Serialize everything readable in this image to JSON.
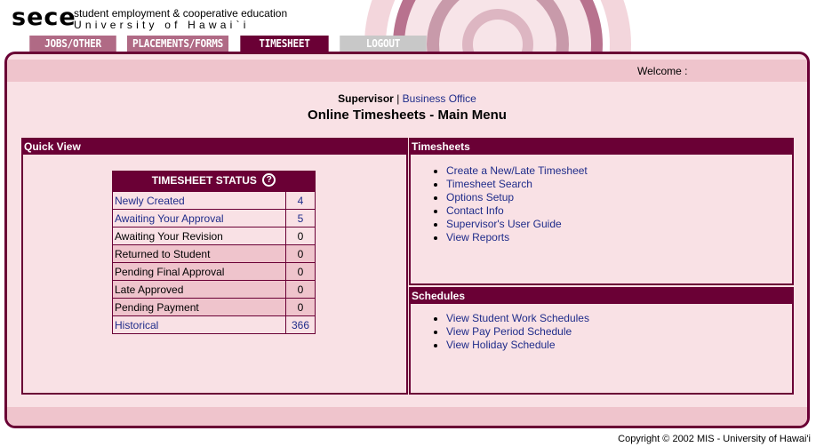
{
  "brand": {
    "mark": "sece",
    "line1": "student employment & cooperative education",
    "line2": "University of Hawai`i"
  },
  "tabs": [
    {
      "label": "JOBS/OTHER"
    },
    {
      "label": "PLACEMENTS/FORMS"
    },
    {
      "label": "TIMESHEET"
    },
    {
      "label": "LOGOUT"
    }
  ],
  "welcome": "Welcome :",
  "role": {
    "current": "Supervisor",
    "separator": "|",
    "other": "Business Office"
  },
  "page_title": "Online Timesheets - Main Menu",
  "quick_view": {
    "title": "Quick View",
    "table_title": "TIMESHEET STATUS",
    "help_glyph": "?",
    "rows": [
      {
        "label": "Newly Created",
        "count": "4"
      },
      {
        "label": "Awaiting Your Approval",
        "count": "5"
      },
      {
        "label": "Awaiting Your Revision",
        "count": "0"
      },
      {
        "label": "Returned to Student",
        "count": "0"
      },
      {
        "label": "Pending Final Approval",
        "count": "0"
      },
      {
        "label": "Late Approved",
        "count": "0"
      },
      {
        "label": "Pending Payment",
        "count": "0"
      },
      {
        "label": "Historical",
        "count": "366"
      }
    ]
  },
  "timesheets": {
    "title": "Timesheets",
    "items": [
      "Create a New/Late Timesheet",
      "Timesheet Search",
      "Options Setup",
      "Contact Info",
      "Supervisor's User Guide",
      "View Reports"
    ]
  },
  "schedules": {
    "title": "Schedules",
    "items": [
      "View Student Work Schedules",
      "View Pay Period Schedule",
      "View Holiday Schedule"
    ]
  },
  "footer": "Copyright © 2002 MIS - University of Hawai'i",
  "colors": {
    "maroon": "#6a0035",
    "pink_bg": "#f9e1e5",
    "pink_band": "#efc4cc",
    "link": "#1f2c8a",
    "tab_inactive": "#b06a85",
    "tab_disabled": "#c8c8c8"
  }
}
